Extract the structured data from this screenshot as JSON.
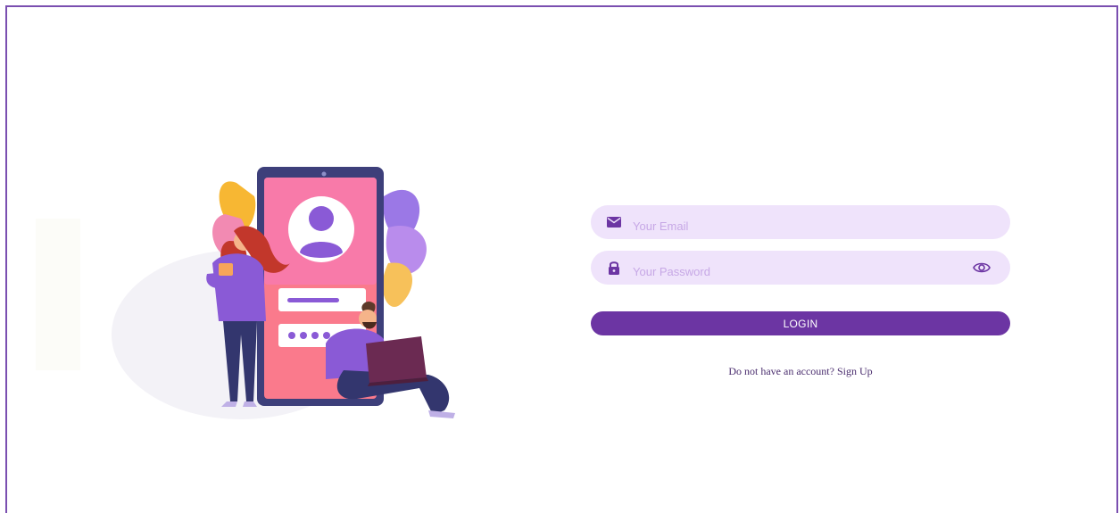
{
  "login_form": {
    "email": {
      "placeholder": "Your Email",
      "value": "",
      "icon": "envelope-icon"
    },
    "password": {
      "placeholder": "Your Password",
      "value": "",
      "icon": "lock-icon",
      "toggle_icon": "eye-icon"
    },
    "login_label": "LOGIN",
    "signup_prompt": "Do not have an account?",
    "signup_link": "Sign Up"
  },
  "colors": {
    "accent": "#6c35a3",
    "field_background": "#efe3fb",
    "placeholder": "#c7a8e6",
    "frame_border": "#7a4fb0"
  }
}
